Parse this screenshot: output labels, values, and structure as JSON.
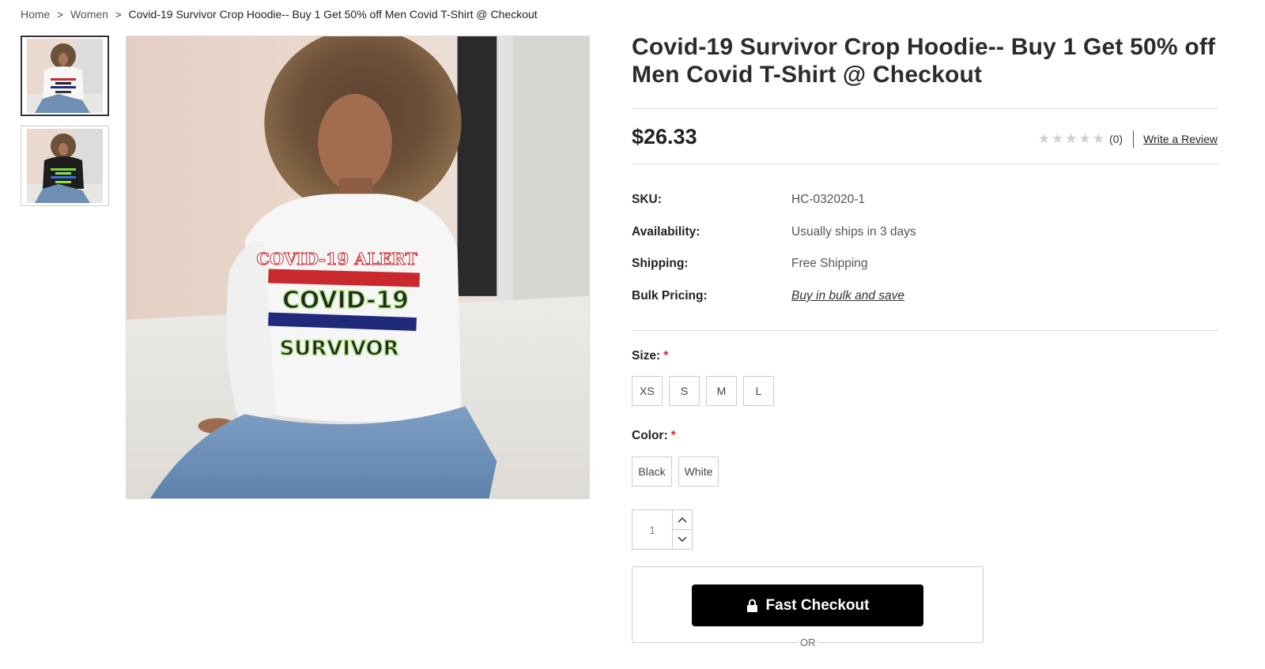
{
  "breadcrumb": {
    "items": [
      "Home",
      "Women",
      "Covid-19 Survivor Crop Hoodie-- Buy 1 Get 50% off Men Covid T-Shirt @ Checkout"
    ],
    "separator": ">"
  },
  "product": {
    "title": "Covid-19 Survivor Crop Hoodie-- Buy 1 Get 50% off Men Covid T-Shirt @ Checkout",
    "price": "$26.33",
    "image_print": {
      "line1": "COVID-19 ALERT",
      "line2": "COVID-19",
      "line3": "SURVIVOR"
    }
  },
  "rating": {
    "stars_filled": 0,
    "stars_total": 5,
    "count": "(0)",
    "write_review": "Write a Review"
  },
  "specs": {
    "sku_label": "SKU:",
    "sku_value": "HC-032020-1",
    "availability_label": "Availability:",
    "availability_value": "Usually ships in 3 days",
    "shipping_label": "Shipping:",
    "shipping_value": "Free Shipping",
    "bulk_label": "Bulk Pricing:",
    "bulk_value": "Buy in bulk and save"
  },
  "options": {
    "size_label": "Size:",
    "required_mark": "*",
    "sizes": [
      "XS",
      "S",
      "M",
      "L"
    ],
    "color_label": "Color:",
    "colors": [
      "Black",
      "White"
    ]
  },
  "quantity": {
    "value": "1"
  },
  "checkout": {
    "fast_checkout_label": "Fast Checkout",
    "or_text": "OR"
  },
  "colors": {
    "star_empty": "#cfcfcf",
    "required": "#c9302c",
    "checkout_button": "#000000",
    "print_red": "#c8282e",
    "print_blue": "#1f2a7a"
  }
}
